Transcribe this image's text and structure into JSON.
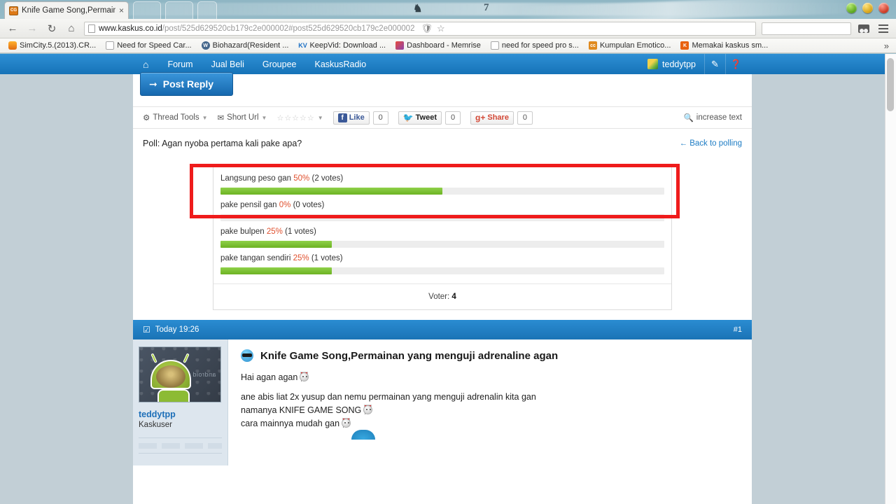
{
  "browser": {
    "tab": {
      "title": "Knife Game Song,Permain",
      "close_label": "×",
      "favicon": "kaskus-favicon"
    },
    "nav": {
      "back_label": "←",
      "forward_label": "→",
      "reload_label": "↻",
      "home_label": "⌂"
    },
    "omnibox": {
      "url_prefix": "www.kaskus.co.id",
      "url_path": "/post/",
      "url_id": "525d629520cb179c2e000002",
      "url_hash": "#post525d629520cb179c2e000002",
      "shield_icon": "shield-icon",
      "star_icon": "star-icon"
    },
    "search_placeholder": "",
    "user_icon": "user-icon",
    "menu_icon": "hamburger-menu-icon",
    "bookmarks": [
      {
        "label": "SimCity.5.(2013).CR...",
        "icon": "simcity"
      },
      {
        "label": "Need for Speed Car...",
        "icon": "blank"
      },
      {
        "label": "Biohazard(Resident ...",
        "icon": "wp"
      },
      {
        "label": "KeepVid: Download ...",
        "icon": "kv"
      },
      {
        "label": "Dashboard - Memrise",
        "icon": "memrise"
      },
      {
        "label": "need for speed pro s...",
        "icon": "blank"
      },
      {
        "label": "Kumpulan Emotico...",
        "icon": "kaskus"
      },
      {
        "label": "Memakai kaskus sm...",
        "icon": "kaskusk"
      }
    ],
    "bookmark_overflow": "»",
    "window_buttons": {
      "minimize": "green",
      "maximize": "yellow",
      "close": "red"
    }
  },
  "desktop": {
    "glyph": "♞",
    "number": "7"
  },
  "kaskus_nav": {
    "home_icon": "home-icon",
    "items": [
      "Forum",
      "Jual Beli",
      "Groupee",
      "KaskusRadio"
    ],
    "username": "teddytpp",
    "compose_icon": "pencil-icon",
    "help_icon": "question-mark-icon"
  },
  "toolbar": {
    "post_reply": "Post Reply",
    "thread_tools": "Thread Tools",
    "short_url": "Short Url",
    "stars": "☆☆☆☆☆",
    "facebook": {
      "label": "Like",
      "count": "0"
    },
    "twitter": {
      "label": "Tweet",
      "count": "0"
    },
    "google": {
      "label": "Share",
      "count": "0"
    },
    "increase_text": "increase text"
  },
  "poll": {
    "title": "Poll: Agan nyoba pertama kali pake apa?",
    "back_link": "← Back to polling",
    "voter_label": "Voter:",
    "voter_count": "4",
    "options": [
      {
        "label": "Langsung peso gan",
        "percent": "50%",
        "votes": "(2 votes)",
        "fill": 50
      },
      {
        "label": "pake pensil gan",
        "percent": "0%",
        "votes": "(0 votes)",
        "fill": 0
      },
      {
        "label": "pake bulpen",
        "percent": "25%",
        "votes": "(1 votes)",
        "fill": 25
      },
      {
        "label": "pake tangan sendiri",
        "percent": "25%",
        "votes": "(1 votes)",
        "fill": 25
      }
    ]
  },
  "post": {
    "timestamp": "Today 19:26",
    "number": "#1",
    "username": "teddytpp",
    "usertitle": "Kaskuser",
    "title": "Knife Game Song,Permainan yang menguji adrenaline agan",
    "lines": [
      "Hai agan agan",
      "ane abis liat 2x yusup dan nemu permainan yang menguji adrenalin kita gan",
      "namanya KNIFE GAME SONG",
      "cara mainnya mudah gan"
    ],
    "avatar_brand": "android"
  },
  "colors": {
    "kaskus_blue": "#1673b8",
    "poll_green": "#7cc134",
    "percent_red": "#e0502e",
    "highlight_red": "#ef1b1b",
    "link_blue": "#1d7cc4"
  }
}
